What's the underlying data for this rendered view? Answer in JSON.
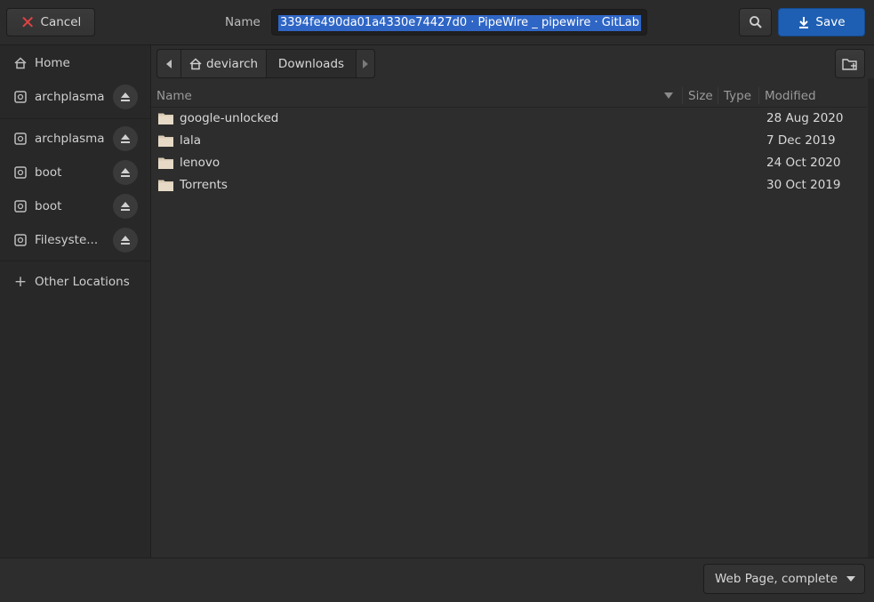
{
  "header": {
    "cancel_label": "Cancel",
    "name_label": "Name",
    "name_value": "3394fe490da01a4330e74427d0 · PipeWire _ pipewire · GitLab",
    "save_label": "Save"
  },
  "sidebar": {
    "items": [
      {
        "label": "Home",
        "icon": "home-icon"
      },
      {
        "label": "archplasma",
        "icon": "drive-icon",
        "eject": true
      },
      {
        "label": "archplasma",
        "icon": "drive-icon",
        "eject": true
      },
      {
        "label": "boot",
        "icon": "drive-icon",
        "eject": true
      },
      {
        "label": "boot",
        "icon": "drive-icon",
        "eject": true
      },
      {
        "label": "Filesyste...",
        "icon": "drive-icon",
        "eject": true
      },
      {
        "label": "Other Locations",
        "icon": "plus-icon"
      }
    ]
  },
  "pathbar": {
    "home_label": "deviarch",
    "current": "Downloads"
  },
  "columns": {
    "name": "Name",
    "size": "Size",
    "type": "Type",
    "modified": "Modified"
  },
  "files": [
    {
      "name": "google-unlocked",
      "modified": "28 Aug 2020"
    },
    {
      "name": "lala",
      "modified": "7 Dec 2019"
    },
    {
      "name": "lenovo",
      "modified": "24 Oct 2020"
    },
    {
      "name": "Torrents",
      "modified": "30 Oct 2019"
    }
  ],
  "footer": {
    "filter_value": "Web Page, complete"
  },
  "colors": {
    "accent": "#1f5fb3",
    "selection": "#2f66c5",
    "cancel_icon": "#e04343",
    "folder": "#d9cbb4"
  }
}
